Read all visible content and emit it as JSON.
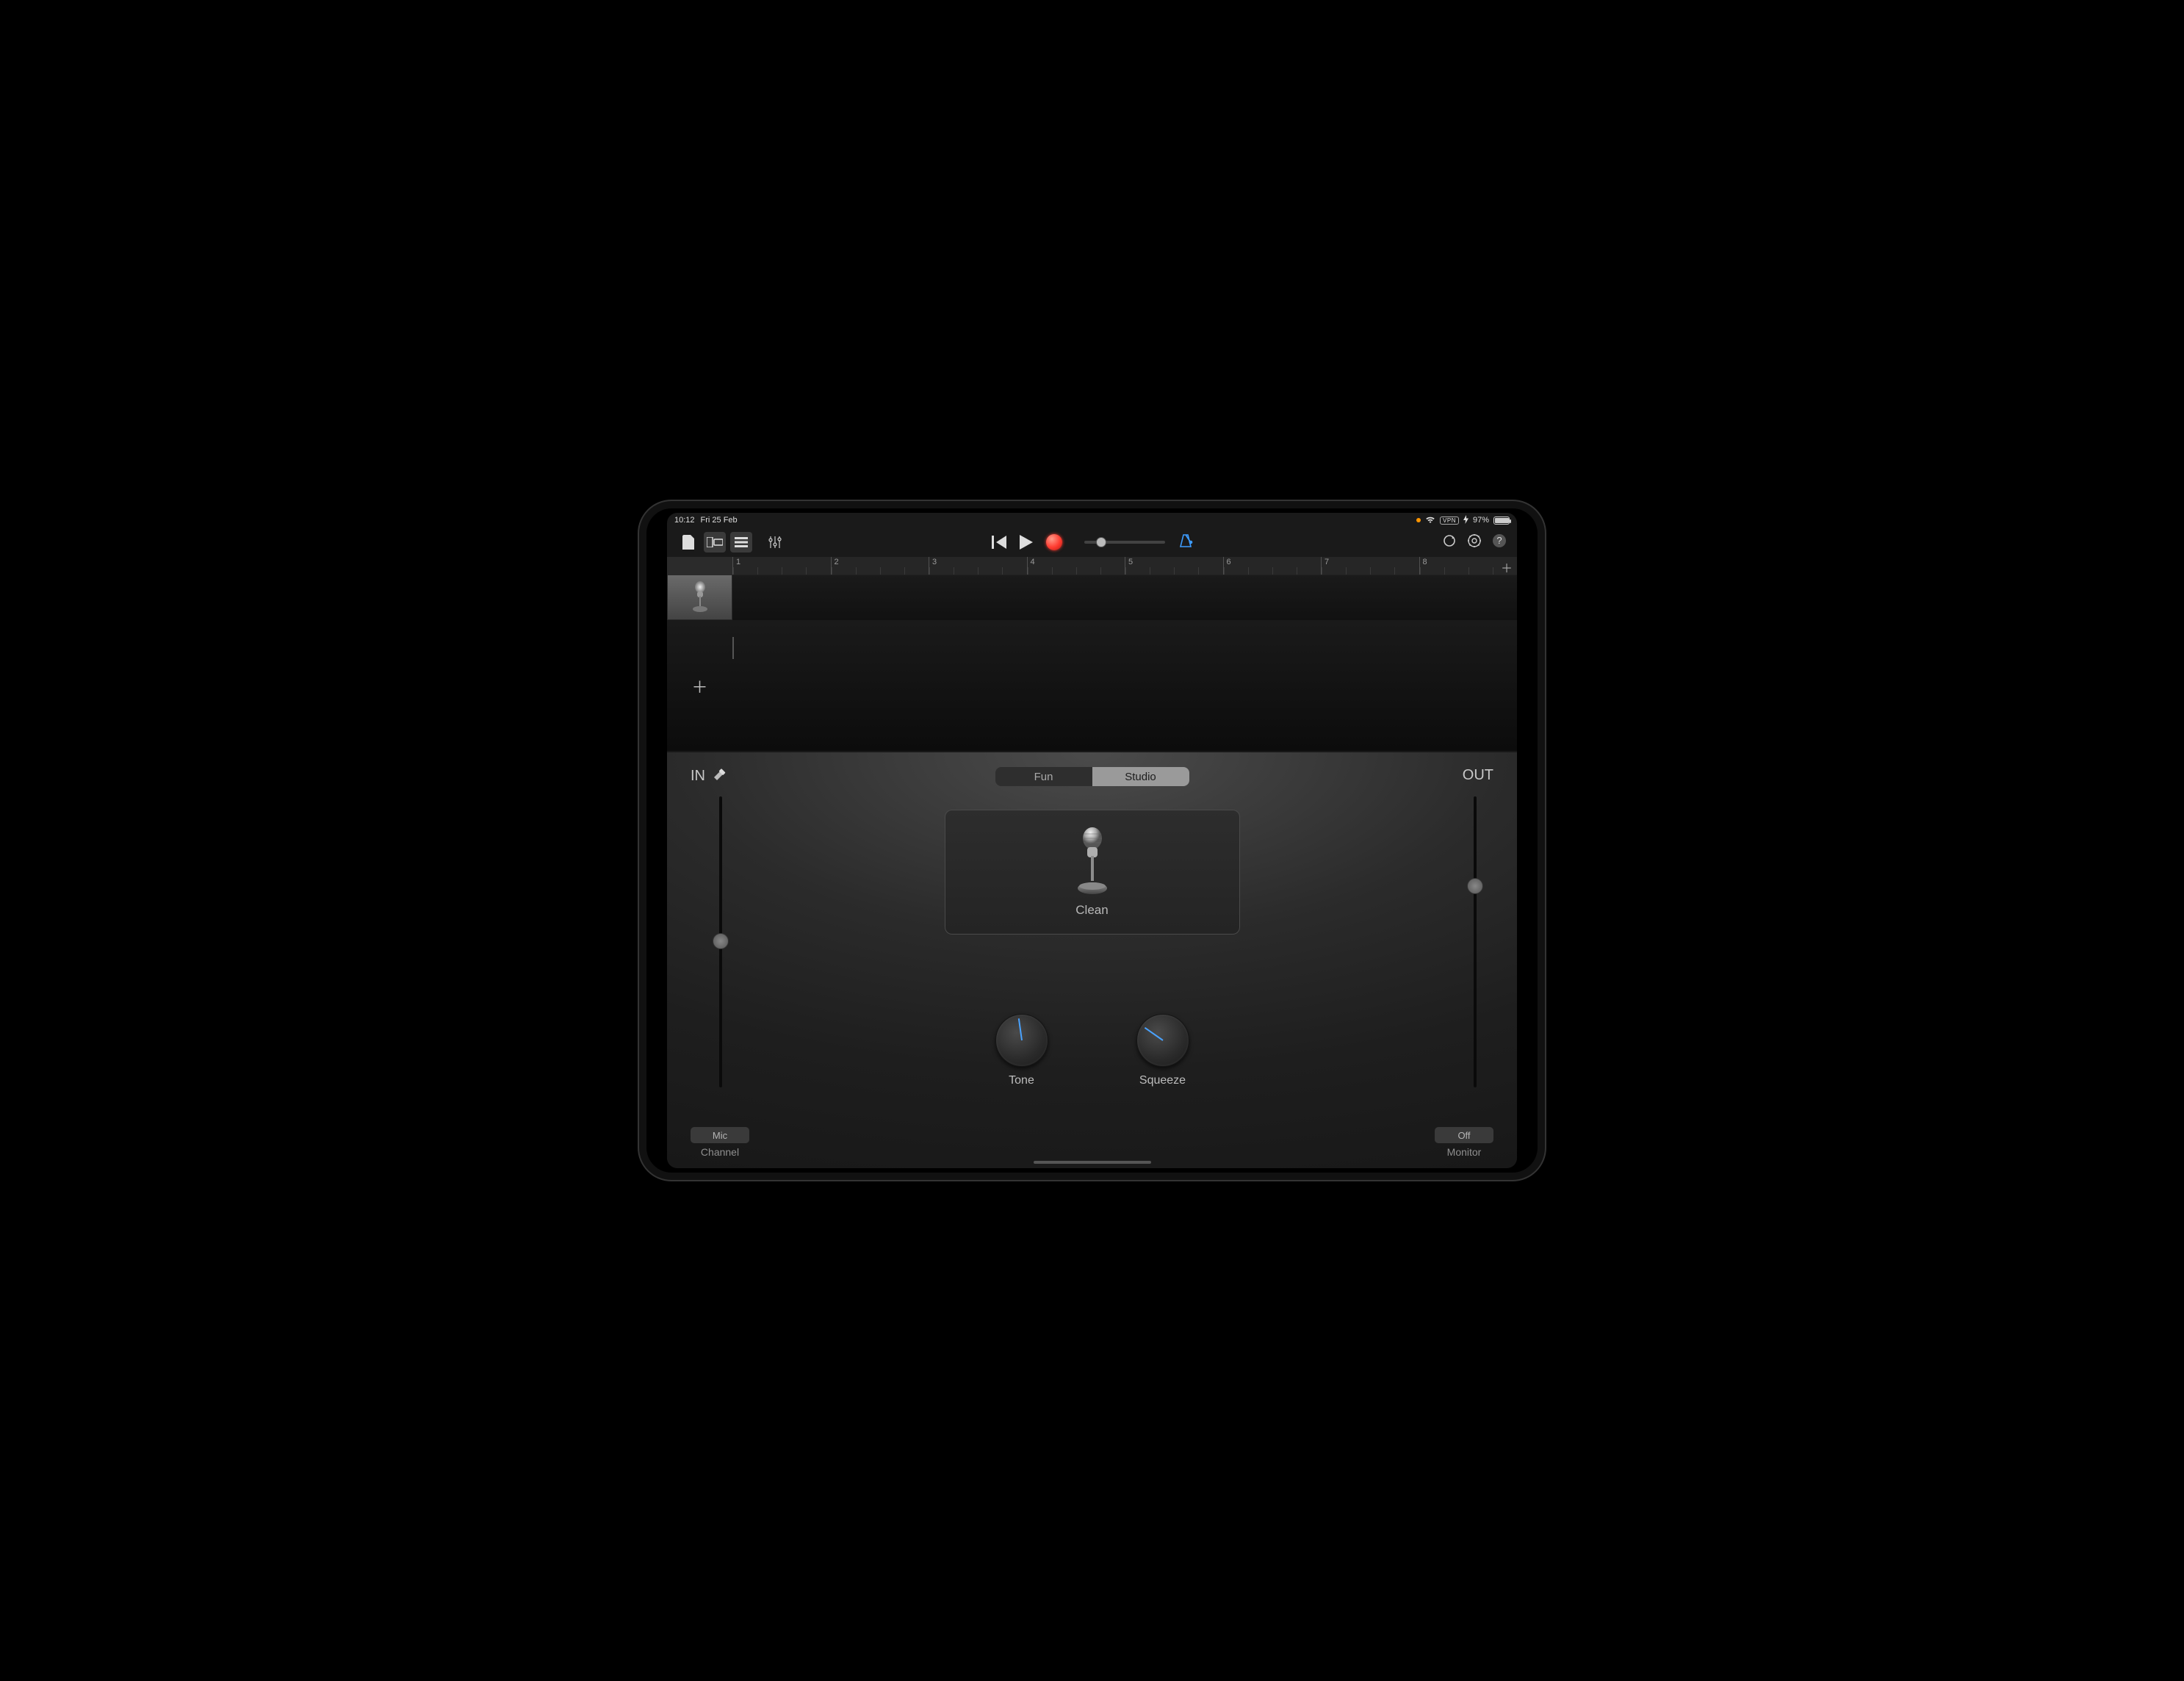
{
  "status": {
    "time": "10:12",
    "date": "Fri 25 Feb",
    "vpn": "VPN",
    "battery_percent": "97%"
  },
  "timeline": {
    "bars": [
      "1",
      "2",
      "3",
      "4",
      "5",
      "6",
      "7",
      "8"
    ]
  },
  "segmented": {
    "fun": "Fun",
    "studio": "Studio"
  },
  "preset": {
    "name": "Clean"
  },
  "io": {
    "in_label": "IN",
    "out_label": "OUT"
  },
  "knobs": {
    "tone": "Tone",
    "squeeze": "Squeeze"
  },
  "bottom": {
    "mic": "Mic",
    "channel": "Channel",
    "off": "Off",
    "monitor": "Monitor"
  }
}
